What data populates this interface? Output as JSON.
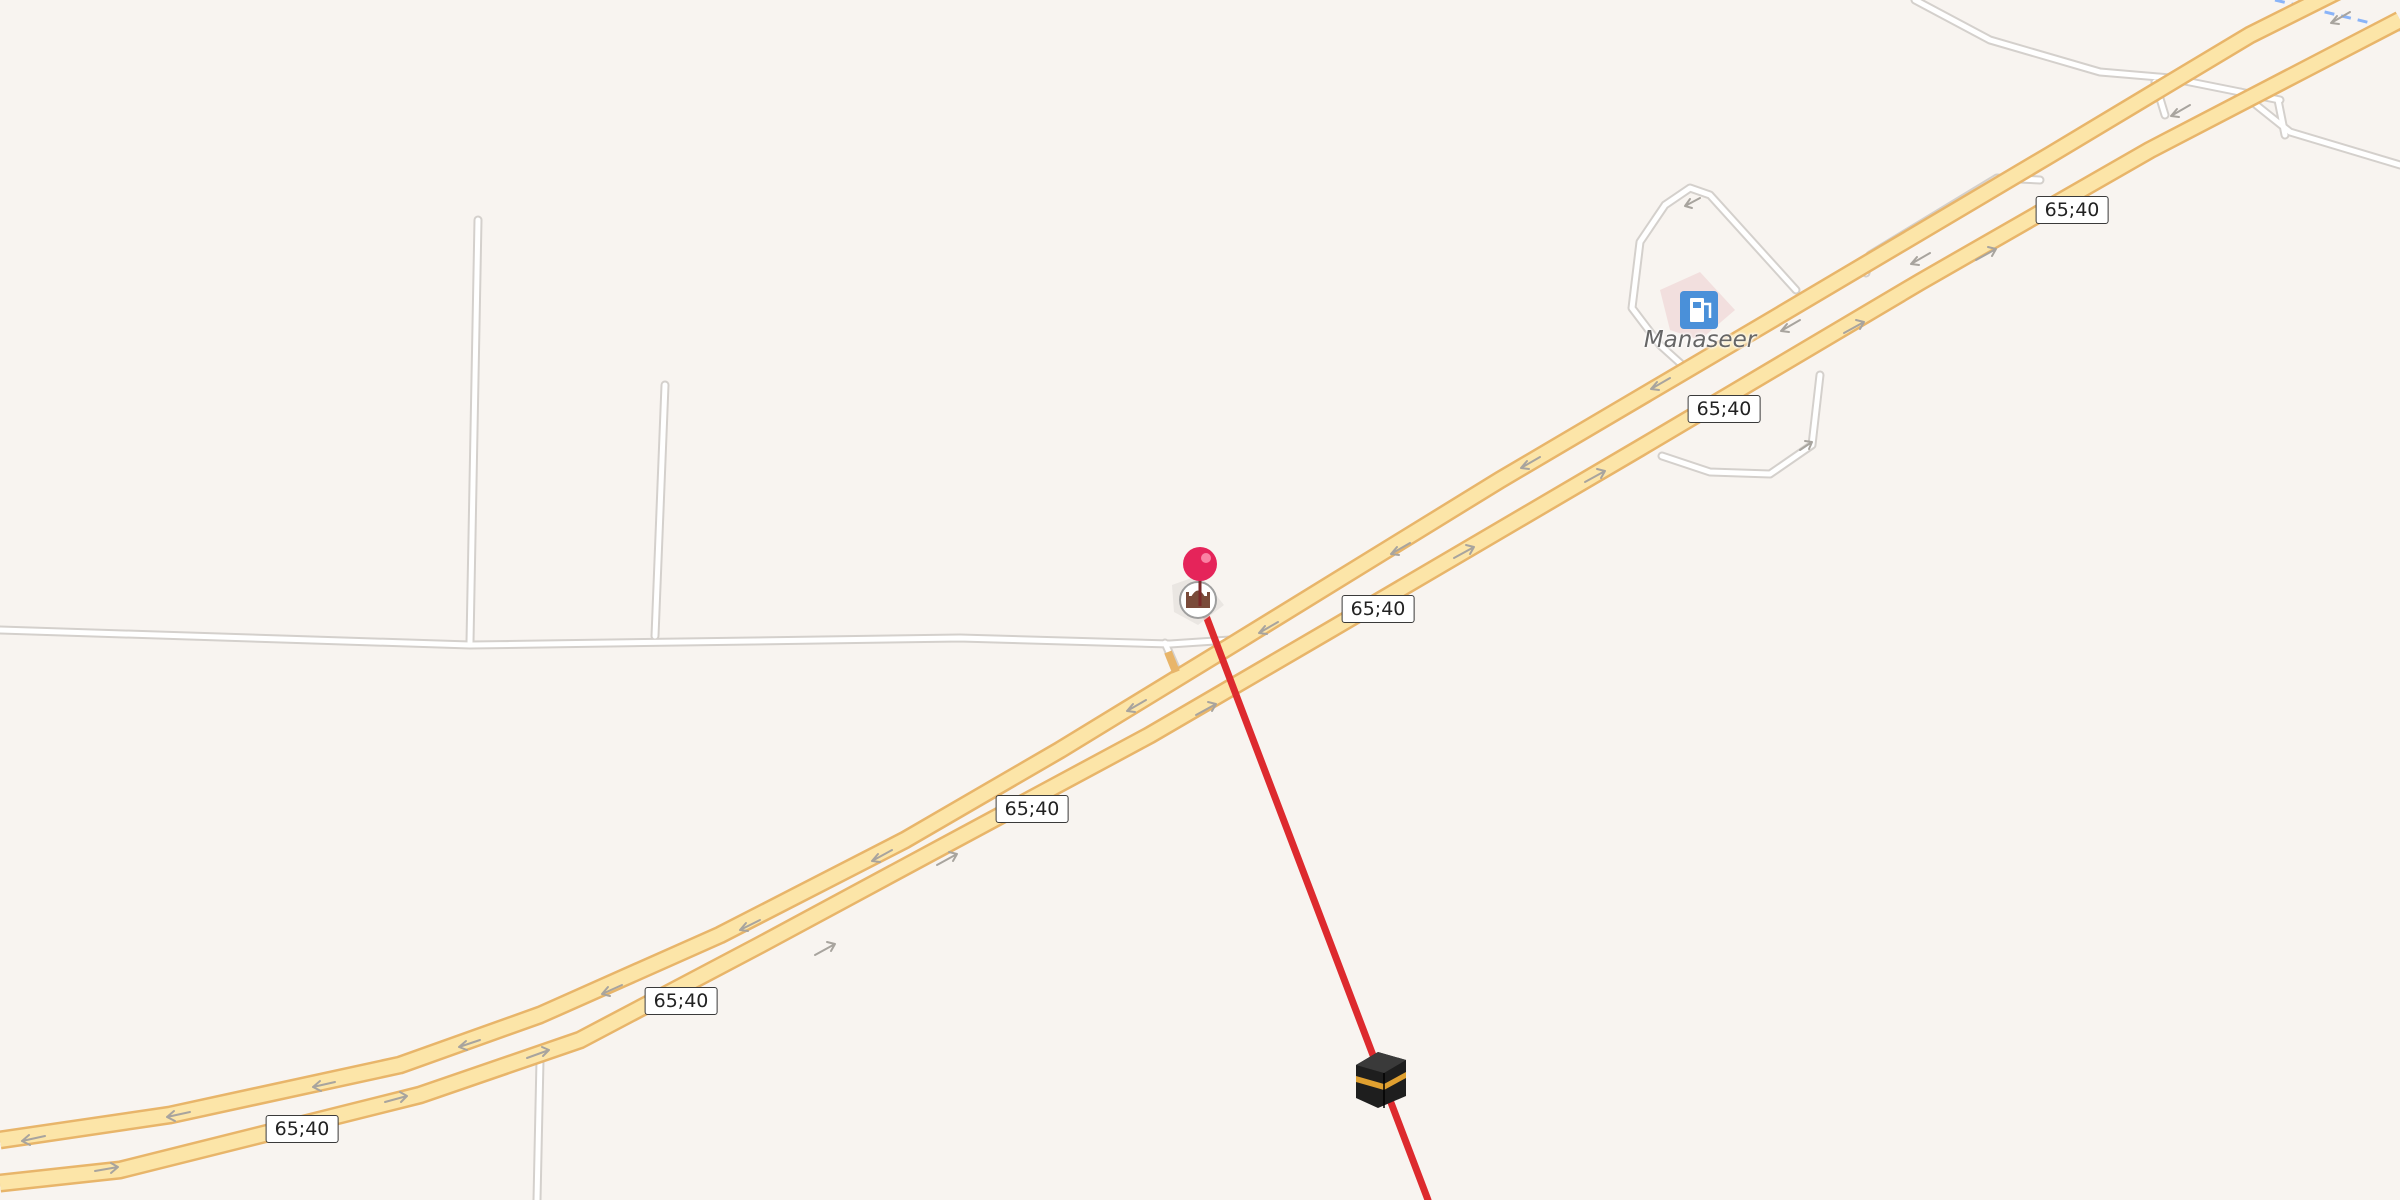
{
  "map": {
    "route_label": "65;40",
    "place_name": "Manaseer",
    "colors": {
      "background": "#f8f4f0",
      "motorway_fill": "#fce5a8",
      "motorway_casing": "#e8b56a",
      "minor_road_fill": "#ffffff",
      "minor_road_casing": "#d4d0cc",
      "qibla_line": "#dd2a2e",
      "pin": "#e5245a",
      "fuel_icon": "#4a90d9",
      "boundary": "#8ab4f8"
    },
    "icons": {
      "pin": "location-pin-icon",
      "poi": "place-of-worship-icon",
      "fuel": "fuel-station-icon",
      "kaaba": "kaaba-icon"
    }
  }
}
